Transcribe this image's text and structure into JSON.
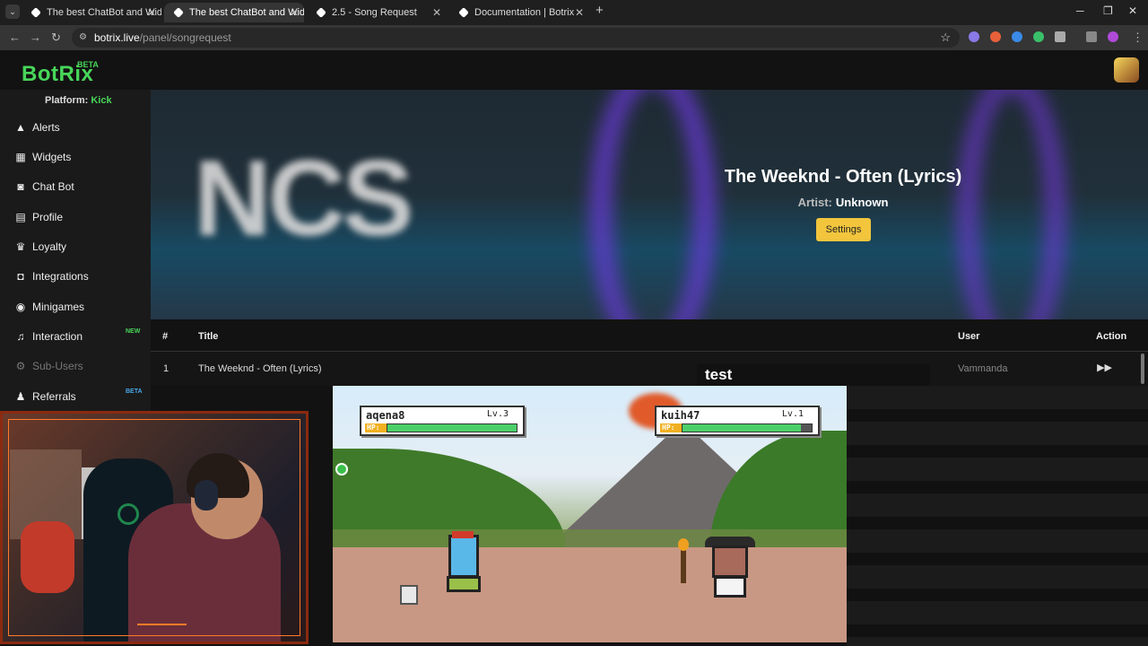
{
  "browser": {
    "tabs": [
      {
        "title": "The best ChatBot and Widgets f",
        "active": false
      },
      {
        "title": "The best ChatBot and Widgets f",
        "active": true
      },
      {
        "title": "2.5 - Song Request",
        "active": false
      },
      {
        "title": "Documentation | Botrix",
        "active": false
      }
    ],
    "url_host": "botrix.live",
    "url_path": "/panel/songrequest"
  },
  "app": {
    "logo": "BotRix",
    "logo_badge": "BETA",
    "platform_label": "Platform:",
    "platform_value": "Kick"
  },
  "sidebar": {
    "items": [
      {
        "label": "Alerts",
        "icon": "warning-icon"
      },
      {
        "label": "Widgets",
        "icon": "widgets-icon"
      },
      {
        "label": "Chat Bot",
        "icon": "robot-icon"
      },
      {
        "label": "Profile",
        "icon": "id-card-icon"
      },
      {
        "label": "Loyalty",
        "icon": "trophy-icon"
      },
      {
        "label": "Integrations",
        "icon": "integrations-icon"
      },
      {
        "label": "Minigames",
        "icon": "gamepad-icon"
      },
      {
        "label": "Interaction",
        "icon": "music-icon",
        "badge": "NEW"
      },
      {
        "label": "Sub-Users",
        "icon": "gear-icon",
        "disabled": true
      },
      {
        "label": "Referrals",
        "icon": "users-icon",
        "badge": "BETA"
      }
    ]
  },
  "now_playing": {
    "title": "The Weeknd - Often (Lyrics)",
    "artist_label": "Artist:",
    "artist": "Unknown",
    "settings_label": "Settings",
    "thumbnail_text": "NCS"
  },
  "queue": {
    "columns": [
      "#",
      "Title",
      "User",
      "Action"
    ],
    "rows": [
      {
        "num": "1",
        "title": "The Weeknd - Often (Lyrics)",
        "user": "Vammanda"
      }
    ]
  },
  "overlay": {
    "test_text": "test"
  },
  "game": {
    "player1": {
      "name": "aqena8",
      "level": "Lv.3",
      "hp_label": "HP:",
      "hp": 1.0
    },
    "player2": {
      "name": "kuih47",
      "level": "Lv.1",
      "hp_label": "HP:",
      "hp": 0.92
    }
  },
  "colors": {
    "accent_green": "#48d65a",
    "settings_yellow": "#f2c53d"
  }
}
